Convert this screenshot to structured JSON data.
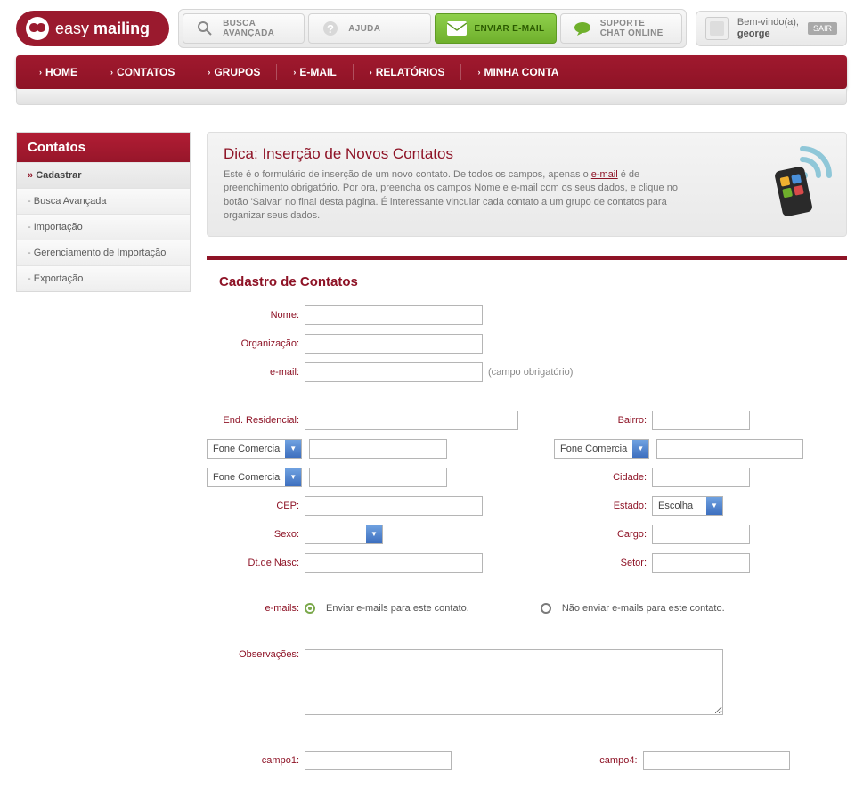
{
  "brand": {
    "name_a": "easy",
    "name_b": "mailing"
  },
  "toolbar": {
    "search": {
      "l1": "BUSCA",
      "l2": "AVANÇADA"
    },
    "help": {
      "l1": "AJUDA"
    },
    "send": {
      "l1": "ENVIAR E-MAIL"
    },
    "chat": {
      "l1": "SUPORTE",
      "l2": "CHAT ONLINE"
    }
  },
  "user": {
    "welcome": "Bem-vindo(a),",
    "name": "george",
    "logout": "SAIR"
  },
  "nav": {
    "home": "HOME",
    "contatos": "CONTATOS",
    "grupos": "GRUPOS",
    "email": "E-MAIL",
    "relatorios": "RELATÓRIOS",
    "conta": "MINHA CONTA"
  },
  "sidebar": {
    "title": "Contatos",
    "items": [
      "Cadastrar",
      "Busca Avançada",
      "Importação",
      "Gerenciamento de Importação",
      "Exportação"
    ]
  },
  "tip": {
    "title": "Dica: Inserção de Novos Contatos",
    "text_a": "Este é o formulário de inserção de um novo contato. De todos os campos, apenas o ",
    "link": "e-mail",
    "text_b": " é de preenchimento obrigatório. Por ora, preencha os campos Nome e e-mail com os seus dados, e clique no botão 'Salvar' no final desta página. É interessante vincular cada contato a um grupo de contatos para organizar seus dados."
  },
  "section_title": "Cadastro de Contatos",
  "labels": {
    "nome": "Nome",
    "org": "Organização",
    "email": "e-mail",
    "hint_email": "(campo obrigatório)",
    "end_res": "End. Residencial",
    "bairro": "Bairro",
    "fone_com": "Fone Comercia",
    "cidade": "Cidade",
    "cep": "CEP",
    "estado": "Estado",
    "estado_opt": "Escolha",
    "sexo": "Sexo",
    "cargo": "Cargo",
    "dtnasc": "Dt.de Nasc",
    "setor": "Setor",
    "emails": "e-mails",
    "opt_send": "Enviar e-mails para este contato.",
    "opt_nosend": "Não enviar e-mails para este contato.",
    "obs": "Observações",
    "campo1": "campo1",
    "campo4": "campo4"
  }
}
